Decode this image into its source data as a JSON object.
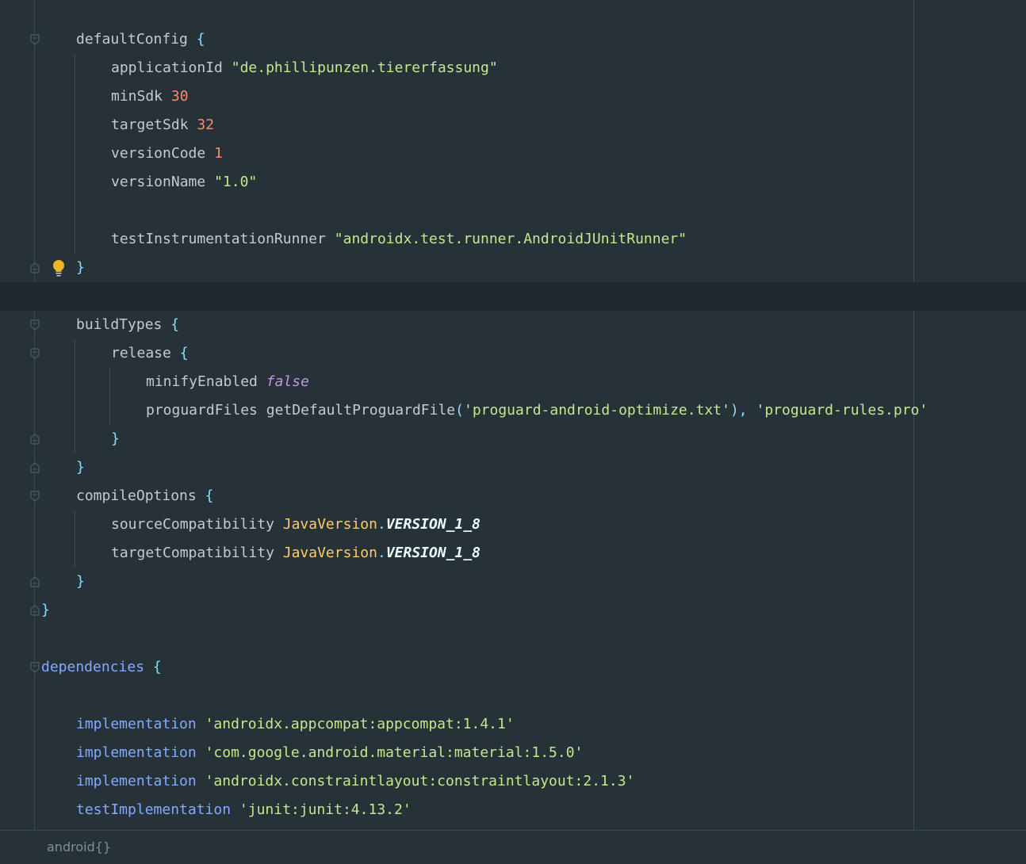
{
  "editor": {
    "lines": {
      "l01": {
        "text": "defaultConfig",
        "brace": "{"
      },
      "l02": {
        "key": "applicationId",
        "value": "\"de.phillipunzen.tiererfassung\""
      },
      "l03": {
        "key": "minSdk",
        "value": "30"
      },
      "l04": {
        "key": "targetSdk",
        "value": "32"
      },
      "l05": {
        "key": "versionCode",
        "value": "1"
      },
      "l06": {
        "key": "versionName",
        "value": "\"1.0\""
      },
      "l08": {
        "key": "testInstrumentationRunner",
        "value": "\"androidx.test.runner.AndroidJUnitRunner\""
      },
      "l09": {
        "brace": "}"
      },
      "l11": {
        "text": "buildTypes",
        "brace": "{"
      },
      "l12": {
        "text": "release",
        "brace": "{"
      },
      "l13": {
        "key": "minifyEnabled",
        "value": "false"
      },
      "l14": {
        "key": "proguardFiles",
        "func": "getDefaultProguardFile",
        "open": "(",
        "arg": "'proguard-android-optimize.txt'",
        "close": "),",
        "arg2": "'proguard-rules.pro'"
      },
      "l15": {
        "brace": "}"
      },
      "l16": {
        "brace": "}"
      },
      "l17": {
        "text": "compileOptions",
        "brace": "{"
      },
      "l18": {
        "key": "sourceCompatibility",
        "cls": "JavaVersion",
        "dot": ".",
        "const": "VERSION_1_8"
      },
      "l19": {
        "key": "targetCompatibility",
        "cls": "JavaVersion",
        "dot": ".",
        "const": "VERSION_1_8"
      },
      "l20": {
        "brace": "}"
      },
      "l21": {
        "brace": "}"
      },
      "l23": {
        "text": "dependencies",
        "brace": "{"
      },
      "l25": {
        "key": "implementation",
        "value": "'androidx.appcompat:appcompat:1.4.1'"
      },
      "l26": {
        "key": "implementation",
        "value": "'com.google.android.material:material:1.5.0'"
      },
      "l27": {
        "key": "implementation",
        "value": "'androidx.constraintlayout:constraintlayout:2.1.3'"
      },
      "l28": {
        "key": "testImplementation",
        "value": "'junit:junit:4.13.2'"
      }
    }
  },
  "status_bar": {
    "breadcrumb": "android{}"
  },
  "icons": {
    "fold_marker": "fold-marker-icon",
    "intention_bulb": "lightbulb-icon"
  },
  "colors": {
    "background": "#263238",
    "current_line": "#1f292f",
    "string": "#c3e88d",
    "number": "#f78c6c",
    "keyword_bool": "#c792ea",
    "class_name": "#ffcb6b",
    "brace": "#89ddff",
    "dependency_keyword": "#82aaff",
    "identifier": "#c0cbd2",
    "bulb": "#f0b429"
  }
}
